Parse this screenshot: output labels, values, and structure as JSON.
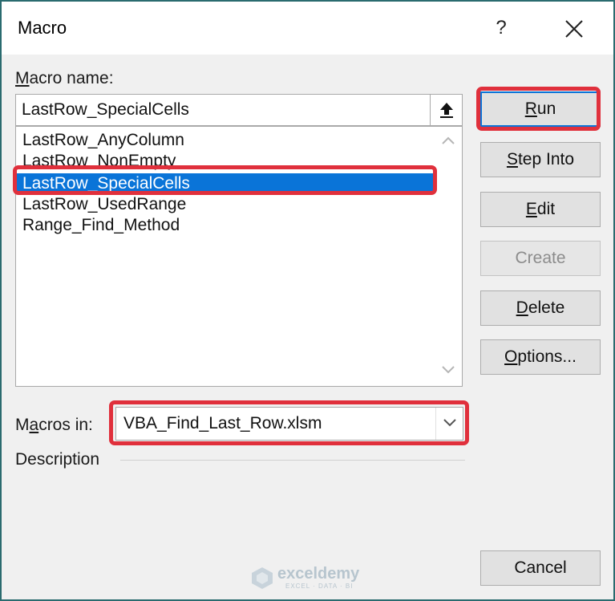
{
  "window": {
    "title": "Macro",
    "help_label": "?"
  },
  "macro_name": {
    "label_first": "M",
    "label_rest": "acro name:",
    "value": "LastRow_SpecialCells"
  },
  "macros_list": {
    "items": [
      "LastRow_AnyColumn",
      "LastRow_NonEmpty",
      "LastRow_SpecialCells",
      "LastRow_UsedRange",
      "Range_Find_Method"
    ],
    "selected_index": 2
  },
  "buttons": {
    "run": {
      "mnemonic": "R",
      "rest": "un"
    },
    "step_into": {
      "mnemonic": "S",
      "rest": "tep Into"
    },
    "edit": {
      "mnemonic": "E",
      "rest": "dit"
    },
    "create": {
      "label": "Create"
    },
    "delete": {
      "mnemonic": "D",
      "rest": "elete"
    },
    "options": {
      "mnemonic": "O",
      "rest": "ptions..."
    },
    "cancel": {
      "label": "Cancel"
    }
  },
  "macros_in": {
    "label_pre": "M",
    "label_mnemonic": "a",
    "label_rest": "cros in:",
    "value": "VBA_Find_Last_Row.xlsm"
  },
  "description": {
    "label": "Description"
  },
  "watermark": {
    "name": "exceldemy",
    "tagline": "EXCEL · DATA · BI"
  },
  "colors": {
    "selection": "#0a74d8",
    "highlight": "#e0303c",
    "frame": "#2a6b6f"
  }
}
